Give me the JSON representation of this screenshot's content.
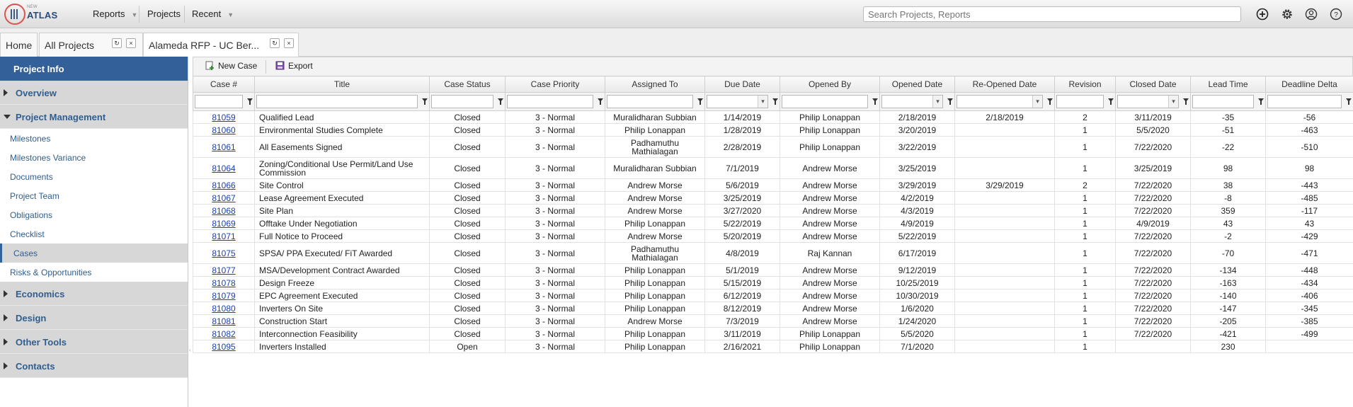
{
  "app": {
    "logo_small": "NEW",
    "logo_word": "ATLAS"
  },
  "nav": [
    {
      "label": "Reports",
      "has_menu": true
    },
    {
      "label": "Projects",
      "has_menu": false
    },
    {
      "label": "Recent",
      "has_menu": true
    }
  ],
  "search": {
    "placeholder": "Search Projects, Reports"
  },
  "top_icons": [
    "add-circle-icon",
    "gear-icon",
    "user-icon",
    "help-icon"
  ],
  "tabs": {
    "home": "Home",
    "all_projects": "All Projects",
    "current": "Alameda RFP - UC Ber..."
  },
  "sidebar": {
    "header": "Project Info",
    "sections_before": [
      {
        "label": "Overview"
      }
    ],
    "expanded_section": "Project Management",
    "links": [
      "Milestones",
      "Milestones Variance",
      "Documents",
      "Project Team",
      "Obligations",
      "Checklist",
      "Cases",
      "Risks & Opportunities"
    ],
    "active_link": "Cases",
    "sections_after": [
      "Economics",
      "Design",
      "Other Tools",
      "Contacts"
    ]
  },
  "toolbar": {
    "new_case": "New Case",
    "export": "Export"
  },
  "table": {
    "columns": [
      {
        "label": "Case #",
        "filter": "text"
      },
      {
        "label": "Title",
        "filter": "text"
      },
      {
        "label": "Case Status",
        "filter": "text"
      },
      {
        "label": "Case Priority",
        "filter": "text"
      },
      {
        "label": "Assigned To",
        "filter": "text"
      },
      {
        "label": "Due Date",
        "filter": "date"
      },
      {
        "label": "Opened By",
        "filter": "text"
      },
      {
        "label": "Opened Date",
        "filter": "date"
      },
      {
        "label": "Re-Opened Date",
        "filter": "date"
      },
      {
        "label": "Revision",
        "filter": "text"
      },
      {
        "label": "Closed Date",
        "filter": "date"
      },
      {
        "label": "Lead Time",
        "filter": "text"
      },
      {
        "label": "Deadline Delta",
        "filter": "text"
      }
    ],
    "rows": [
      [
        "81059",
        "Qualified Lead",
        "Closed",
        "3 - Normal",
        "Muralidharan Subbian",
        "1/14/2019",
        "Philip Lonappan",
        "2/18/2019",
        "2/18/2019",
        "2",
        "3/11/2019",
        "-35",
        "-56"
      ],
      [
        "81060",
        "Environmental Studies Complete",
        "Closed",
        "3 - Normal",
        "Philip Lonappan",
        "1/28/2019",
        "Philip Lonappan",
        "3/20/2019",
        "",
        "1",
        "5/5/2020",
        "-51",
        "-463"
      ],
      [
        "81061",
        "All Easements Signed",
        "Closed",
        "3 - Normal",
        "Padhamuthu Mathialagan",
        "2/28/2019",
        "Philip Lonappan",
        "3/22/2019",
        "",
        "1",
        "7/22/2020",
        "-22",
        "-510"
      ],
      [
        "81064",
        "Zoning/Conditional Use Permit/Land Use Commission",
        "Closed",
        "3 - Normal",
        "Muralidharan Subbian",
        "7/1/2019",
        "Andrew Morse",
        "3/25/2019",
        "",
        "1",
        "3/25/2019",
        "98",
        "98"
      ],
      [
        "81066",
        "Site Control",
        "Closed",
        "3 - Normal",
        "Andrew Morse",
        "5/6/2019",
        "Andrew Morse",
        "3/29/2019",
        "3/29/2019",
        "2",
        "7/22/2020",
        "38",
        "-443"
      ],
      [
        "81067",
        "Lease Agreement Executed",
        "Closed",
        "3 - Normal",
        "Andrew Morse",
        "3/25/2019",
        "Andrew Morse",
        "4/2/2019",
        "",
        "1",
        "7/22/2020",
        "-8",
        "-485"
      ],
      [
        "81068",
        "Site Plan",
        "Closed",
        "3 - Normal",
        "Andrew Morse",
        "3/27/2020",
        "Andrew Morse",
        "4/3/2019",
        "",
        "1",
        "7/22/2020",
        "359",
        "-117"
      ],
      [
        "81069",
        "Offtake Under Negotiation",
        "Closed",
        "3 - Normal",
        "Philip Lonappan",
        "5/22/2019",
        "Andrew Morse",
        "4/9/2019",
        "",
        "1",
        "4/9/2019",
        "43",
        "43"
      ],
      [
        "81071",
        "Full Notice to Proceed",
        "Closed",
        "3 - Normal",
        "Andrew Morse",
        "5/20/2019",
        "Andrew Morse",
        "5/22/2019",
        "",
        "1",
        "7/22/2020",
        "-2",
        "-429"
      ],
      [
        "81075",
        "SPSA/ PPA Executed/ FiT Awarded",
        "Closed",
        "3 - Normal",
        "Padhamuthu Mathialagan",
        "4/8/2019",
        "Raj Kannan",
        "6/17/2019",
        "",
        "1",
        "7/22/2020",
        "-70",
        "-471"
      ],
      [
        "81077",
        "MSA/Development Contract Awarded",
        "Closed",
        "3 - Normal",
        "Philip Lonappan",
        "5/1/2019",
        "Andrew Morse",
        "9/12/2019",
        "",
        "1",
        "7/22/2020",
        "-134",
        "-448"
      ],
      [
        "81078",
        "Design Freeze",
        "Closed",
        "3 - Normal",
        "Philip Lonappan",
        "5/15/2019",
        "Andrew Morse",
        "10/25/2019",
        "",
        "1",
        "7/22/2020",
        "-163",
        "-434"
      ],
      [
        "81079",
        "EPC Agreement Executed",
        "Closed",
        "3 - Normal",
        "Philip Lonappan",
        "6/12/2019",
        "Andrew Morse",
        "10/30/2019",
        "",
        "1",
        "7/22/2020",
        "-140",
        "-406"
      ],
      [
        "81080",
        "Inverters On Site",
        "Closed",
        "3 - Normal",
        "Philip Lonappan",
        "8/12/2019",
        "Andrew Morse",
        "1/6/2020",
        "",
        "1",
        "7/22/2020",
        "-147",
        "-345"
      ],
      [
        "81081",
        "Construction Start",
        "Closed",
        "3 - Normal",
        "Andrew Morse",
        "7/3/2019",
        "Andrew Morse",
        "1/24/2020",
        "",
        "1",
        "7/22/2020",
        "-205",
        "-385"
      ],
      [
        "81082",
        "Interconnection Feasibility",
        "Closed",
        "3 - Normal",
        "Philip Lonappan",
        "3/11/2019",
        "Philip Lonappan",
        "5/5/2020",
        "",
        "1",
        "7/22/2020",
        "-421",
        "-499"
      ],
      [
        "81095",
        "Inverters Installed",
        "Open",
        "3 - Normal",
        "Philip Lonappan",
        "2/16/2021",
        "Philip Lonappan",
        "7/1/2020",
        "",
        "1",
        "",
        "230",
        ""
      ]
    ]
  }
}
